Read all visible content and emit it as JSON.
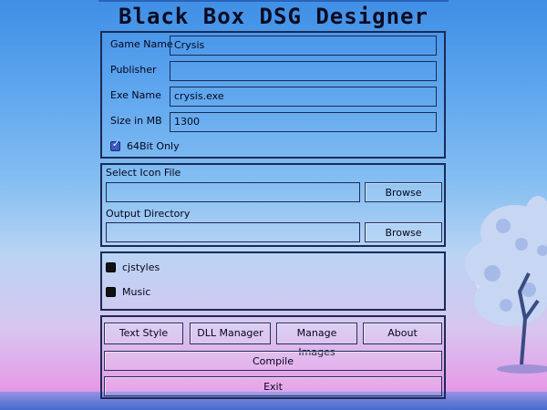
{
  "app": {
    "title": "Black Box DSG Designer"
  },
  "game_info": {
    "game_name_label": "Game Name",
    "game_name_value": "Crysis",
    "publisher_label": "Publisher",
    "publisher_value": "",
    "exe_name_label": "Exe Name",
    "exe_name_value": "crysis.exe",
    "size_label": "Size in MB",
    "size_value": "1300",
    "bit64_label": "64Bit Only",
    "bit64_checked": true
  },
  "files": {
    "icon_label": "Select Icon File",
    "icon_value": "",
    "icon_browse": "Browse",
    "output_label": "Output Directory",
    "output_value": "",
    "output_browse": "Browse"
  },
  "options": {
    "cjstyles_label": "cjstyles",
    "cjstyles_checked": false,
    "music_label": "Music",
    "music_checked": false
  },
  "actions": {
    "text_style": "Text Style",
    "dll_manager": "DLL Manager",
    "manage_images": "Manage Images",
    "about": "About",
    "compile": "Compile",
    "exit": "Exit"
  }
}
